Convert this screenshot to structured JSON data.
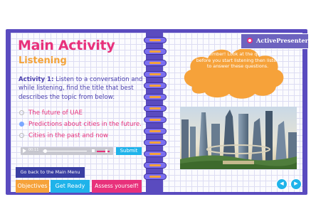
{
  "left_page": {
    "title": "Main Activity",
    "subtitle": "Listening",
    "instruction_label": "Activity 1:",
    "instruction_text": " Listen to a conversation and while listening, find the title that best describes the topic from below:",
    "options": [
      {
        "label": "The future of UAE",
        "selected": false
      },
      {
        "label": "Predictions about cities in the future.",
        "selected": true
      },
      {
        "label": "Cities in the past and now",
        "selected": false
      }
    ],
    "audio": {
      "time": "00:11",
      "progress": 0.05,
      "volume": 0.7
    },
    "submit_label": "Submit",
    "main_menu_label": "Go back to the  Main  Menu",
    "objectives_label": "Objectives",
    "get_ready_label": "Get Ready",
    "assess_label": "Assess yourself!"
  },
  "right_page": {
    "brand": "ActivePresenter",
    "note": "Remember! Look at the questions before you start listening then listen to answer these questions.",
    "photo_icon": "futuristic-city-photo",
    "prev_icon": "chevron-left-icon",
    "next_icon": "chevron-right-icon",
    "prev_glyph": "◀",
    "next_glyph": "▶"
  },
  "colors": {
    "frame": "#5a4bbf",
    "title": "#e8317b",
    "subtitle": "#f4a43a",
    "accent_blue": "#1fb3ea",
    "note_cloud": "#f6a23a"
  }
}
